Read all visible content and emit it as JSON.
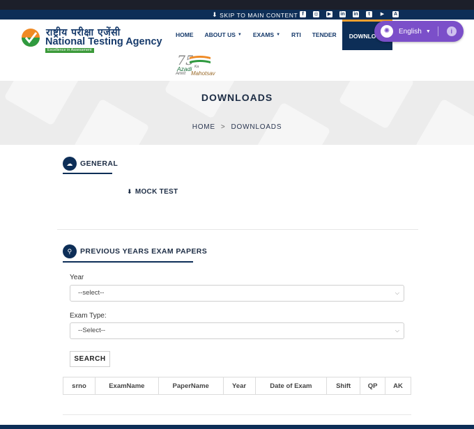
{
  "skip_bar": {
    "skip_label": "SKIP TO MAIN CONTENT"
  },
  "social_icons": [
    "facebook-icon",
    "instagram-icon",
    "youtube-icon",
    "linkedin-icon",
    "linkedin-in-icon",
    "twitter-icon",
    "play-store-icon",
    "app-store-icon"
  ],
  "logo": {
    "hindi": "राष्ट्रीय परीक्षा एजेंसी",
    "english": "National Testing Agency",
    "tagline": "Excellence in Assessment"
  },
  "nav": {
    "home": "HOME",
    "about": "ABOUT US",
    "exams": "EXAMS",
    "rti": "RTI",
    "tender": "TENDER",
    "downloads": "DOWNLO"
  },
  "azadi": {
    "number": "75",
    "line1": "Azadi",
    "line2": "Amrit",
    "ka": "Ka",
    "line3": "Mahotsav"
  },
  "language": {
    "label": "English"
  },
  "banner": {
    "title": "DOWNLOADS",
    "crumb_home": "HOME",
    "crumb_sep": ">",
    "crumb_current": "DOWNLOADS"
  },
  "general": {
    "title": "GENERAL",
    "mock_test": "MOCK TEST"
  },
  "previous": {
    "title": "PREVIOUS YEARS EXAM PAPERS",
    "year_label": "Year",
    "year_value": "--select--",
    "exam_type_label": "Exam Type:",
    "exam_type_value": "--Select--",
    "search_label": "SEARCH",
    "columns": [
      "srno",
      "ExamName",
      "PaperName",
      "Year",
      "Date of Exam",
      "Shift",
      "QP",
      "AK"
    ]
  },
  "colors": {
    "primary": "#0d2e57",
    "accent": "#f0a030",
    "lang_pill": "#7b4fc9"
  }
}
